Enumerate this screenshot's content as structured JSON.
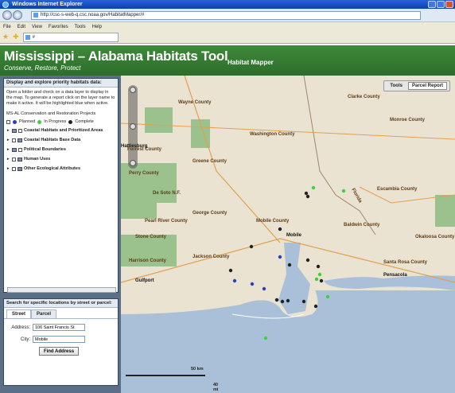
{
  "browser": {
    "window_title": "Windows Internet Explorer",
    "url": "http://csc-s-web-q.csc.noaa.gov/HabitatMapper/#",
    "menu": [
      "File",
      "Edit",
      "View",
      "Favorites",
      "Tools",
      "Help"
    ]
  },
  "app": {
    "title": "Mississippi – Alabama Habitats Tool",
    "tagline": "Conserve, Restore, Protect",
    "subtitle": "Habitat Mapper"
  },
  "layers_panel": {
    "heading": "Display and explore priority habitats data:",
    "instructions": "Open a folder and check on a data layer to display in the map. To generate a report click on the layer name to make it active. It will be highlighted blue when active.",
    "project_title": "MS-AL Conservation and Restoration Projects",
    "legend": [
      {
        "label": "Planned",
        "color": "#2a3fbf"
      },
      {
        "label": "In Progress",
        "color": "#3fcf3f"
      },
      {
        "label": "Complete",
        "color": "#222222"
      }
    ],
    "layers": [
      "Coastal Habitats and Prioritized Areas",
      "Coastal Habitats Base Data",
      "Political Boundaries",
      "Human Uses",
      "Other Ecological Attributes"
    ]
  },
  "search_panel": {
    "heading": "Search for specific locations by street or parcel:",
    "tabs": [
      "Street",
      "Parcel"
    ],
    "address_label": "Address:",
    "address_value": "106 Saint Francis St",
    "city_label": "City:",
    "city_value": "Mobile",
    "find_label": "Find Address"
  },
  "map": {
    "toolbar": {
      "tools": "Tools",
      "report": "Parcel Report"
    },
    "counties": [
      {
        "name": "Wayne County"
      },
      {
        "name": "Clarke County"
      },
      {
        "name": "Monroe County"
      },
      {
        "name": "Washington County"
      },
      {
        "name": "Greene County"
      },
      {
        "name": "De Soto N.F."
      },
      {
        "name": "George County"
      },
      {
        "name": "Mobile County"
      },
      {
        "name": "Baldwin County"
      },
      {
        "name": "Jackson County"
      },
      {
        "name": "Harrison County"
      },
      {
        "name": "Pearl River County"
      },
      {
        "name": "Stone County"
      },
      {
        "name": "Perry County"
      },
      {
        "name": "Escambia County"
      },
      {
        "name": "Okaloosa County"
      },
      {
        "name": "Forrest County"
      },
      {
        "name": "Santa Rosa County"
      },
      {
        "name": "Florida"
      }
    ],
    "cities": [
      "Mobile",
      "Gulfport",
      "Pensacola",
      "Hattiesburg"
    ],
    "scale": {
      "km": "50 km",
      "mi": "40 mi"
    }
  }
}
